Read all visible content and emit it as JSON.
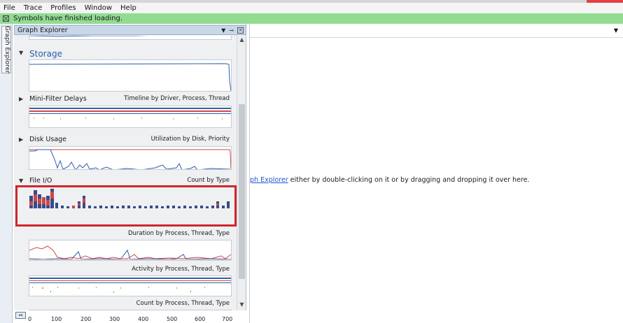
{
  "menu": {
    "items": [
      "File",
      "Trace",
      "Profiles",
      "Window",
      "Help"
    ]
  },
  "status": {
    "message": "Symbols have finished loading."
  },
  "side_tab": {
    "label": "Graph Explorer"
  },
  "panel": {
    "title": "Graph Explorer",
    "controls": {
      "dropdown": "▼",
      "pin": "⊸",
      "close": "×"
    },
    "graphs": [
      {
        "name": "Storage",
        "view": ""
      },
      {
        "name": "Mini-Filter Delays",
        "view": "Timeline by Driver, Process, Thread"
      },
      {
        "name": "Disk Usage",
        "view": "Utilization by Disk, Priority"
      },
      {
        "name": "File I/O",
        "view": "Count by Type"
      },
      {
        "name": "",
        "view": "Duration by Process, Thread, Type"
      },
      {
        "name": "",
        "view": "Activity by Process, Thread, Type"
      },
      {
        "name": "",
        "view": "Count by Process, Thread, Type"
      }
    ],
    "axis_ticks": [
      "0",
      "100",
      "200",
      "300",
      "400",
      "500",
      "600",
      "700"
    ]
  },
  "main": {
    "message_link": "ph Explorer",
    "message_rest": " either by double-clicking on it or by dragging and dropping it over here.",
    "dropdown_icon": "▼"
  },
  "colors": {
    "status_bg": "#91dc91",
    "highlight": "#d0262b",
    "graph_blue": "#2f5fa8",
    "graph_red": "#d14646"
  }
}
